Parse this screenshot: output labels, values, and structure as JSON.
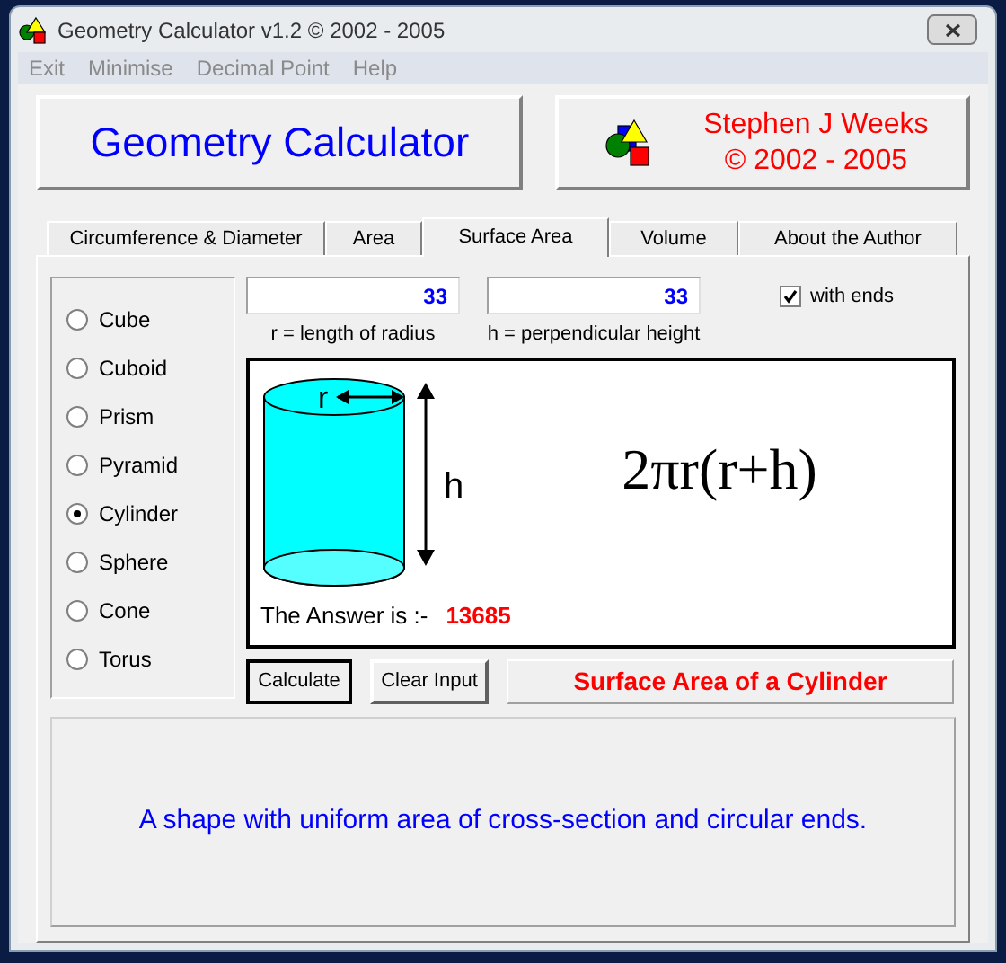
{
  "window": {
    "title": "Geometry Calculator v1.2 ©  2002 - 2005"
  },
  "menu": [
    "Exit",
    "Minimise",
    "Decimal Point",
    "Help"
  ],
  "header": {
    "title": "Geometry Calculator",
    "author": "Stephen J Weeks",
    "copyright": "© 2002 - 2005"
  },
  "tabs": [
    {
      "label": "Circumference & Diameter",
      "selected": false
    },
    {
      "label": "Area",
      "selected": false
    },
    {
      "label": "Surface Area",
      "selected": true
    },
    {
      "label": "Volume",
      "selected": false
    },
    {
      "label": "About the Author",
      "selected": false
    }
  ],
  "shapes": [
    {
      "label": "Cube",
      "selected": false
    },
    {
      "label": "Cuboid",
      "selected": false
    },
    {
      "label": "Prism",
      "selected": false
    },
    {
      "label": "Pyramid",
      "selected": false
    },
    {
      "label": "Cylinder",
      "selected": true
    },
    {
      "label": "Sphere",
      "selected": false
    },
    {
      "label": "Cone",
      "selected": false
    },
    {
      "label": "Torus",
      "selected": false
    }
  ],
  "inputs": [
    {
      "value": "33",
      "caption": "r = length of radius"
    },
    {
      "value": "33",
      "caption": "h = perpendicular height"
    }
  ],
  "with_ends": {
    "label": "with ends",
    "checked": true
  },
  "diagram": {
    "radius_label": "r",
    "height_label": "h",
    "formula": "2πr(r+h)",
    "answer_label": "The Answer is :-",
    "answer": "13685"
  },
  "buttons": [
    "Calculate",
    "Clear Input"
  ],
  "result_title": "Surface Area of a Cylinder",
  "description": "A shape with uniform area of cross-section and circular ends."
}
